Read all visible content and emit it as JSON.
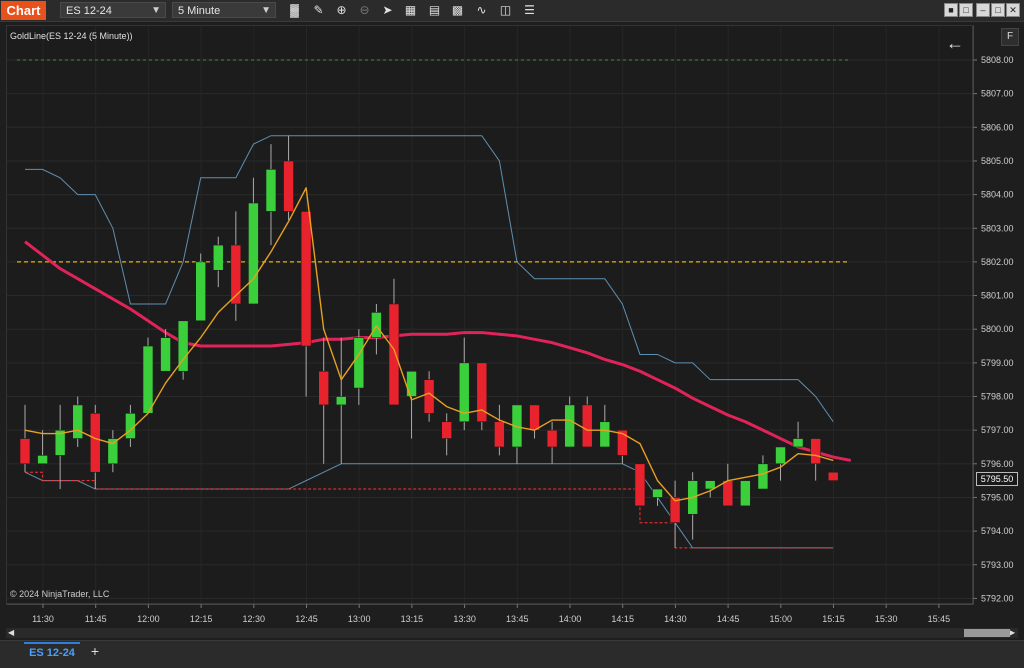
{
  "toolbar": {
    "title": "Chart",
    "instrument": "ES 12-24",
    "interval": "5 Minute",
    "icons": [
      "bar-type-icon",
      "draw-pencil-icon",
      "zoom-in-icon",
      "zoom-out-icon",
      "pointer-icon",
      "properties-icon",
      "strategies-icon",
      "indicators-icon",
      "chart-trader-icon",
      "data-box-icon"
    ]
  },
  "chart": {
    "indicator_label": "GoldLine(ES 12-24 (5 Minute))",
    "copyright": "© 2024 NinjaTrader, LLC",
    "f_button": "F",
    "current_price": "5795.50",
    "price_labels": [
      "5808.00",
      "5807.00",
      "5806.00",
      "5805.00",
      "5804.00",
      "5803.00",
      "5802.00",
      "5801.00",
      "5800.00",
      "5799.00",
      "5798.00",
      "5797.00",
      "5796.00",
      "5795.00",
      "5794.00",
      "5793.00",
      "5792.00"
    ],
    "time_labels": [
      "11:30",
      "11:45",
      "12:00",
      "12:15",
      "12:30",
      "12:45",
      "13:00",
      "13:15",
      "13:30",
      "13:45",
      "14:00",
      "14:15",
      "14:30",
      "14:45",
      "15:00",
      "15:15",
      "15:30",
      "15:45"
    ],
    "colors": {
      "up": "#3ccf3c",
      "down": "#e8232e",
      "ma": "#e0245a",
      "goldline": "#e8a020",
      "channel": "#5f8fb0",
      "hline_green": "#2e9a3a",
      "hline_gold": "#e8b000",
      "stop": "#ff3030"
    }
  },
  "chart_data": {
    "type": "candlestick",
    "title": "GoldLine(ES 12-24 (5 Minute))",
    "ylim": [
      5792,
      5808.5
    ],
    "horizontal_lines": [
      5808.0,
      5802.0
    ],
    "candles": [
      {
        "o": 5796.75,
        "h": 5797.75,
        "l": 5795.75,
        "c": 5796.0
      },
      {
        "o": 5796.0,
        "h": 5797.0,
        "l": 5796.0,
        "c": 5796.25
      },
      {
        "o": 5796.25,
        "h": 5797.75,
        "l": 5795.25,
        "c": 5797.0
      },
      {
        "o": 5796.75,
        "h": 5798.0,
        "l": 5796.5,
        "c": 5797.75
      },
      {
        "o": 5797.5,
        "h": 5797.75,
        "l": 5795.25,
        "c": 5795.75
      },
      {
        "o": 5796.0,
        "h": 5797.0,
        "l": 5795.75,
        "c": 5796.75
      },
      {
        "o": 5796.75,
        "h": 5797.75,
        "l": 5796.5,
        "c": 5797.5
      },
      {
        "o": 5797.5,
        "h": 5799.75,
        "l": 5797.5,
        "c": 5799.5
      },
      {
        "o": 5798.75,
        "h": 5800.0,
        "l": 5798.75,
        "c": 5799.75
      },
      {
        "o": 5798.75,
        "h": 5800.25,
        "l": 5798.5,
        "c": 5800.25
      },
      {
        "o": 5800.25,
        "h": 5802.25,
        "l": 5800.25,
        "c": 5802.0
      },
      {
        "o": 5801.75,
        "h": 5802.75,
        "l": 5801.25,
        "c": 5802.5
      },
      {
        "o": 5802.5,
        "h": 5803.5,
        "l": 5800.25,
        "c": 5800.75
      },
      {
        "o": 5800.75,
        "h": 5804.5,
        "l": 5800.75,
        "c": 5803.75
      },
      {
        "o": 5803.5,
        "h": 5805.5,
        "l": 5802.5,
        "c": 5804.75
      },
      {
        "o": 5805.0,
        "h": 5805.75,
        "l": 5803.25,
        "c": 5803.5
      },
      {
        "o": 5803.5,
        "h": 5803.5,
        "l": 5798.0,
        "c": 5799.5
      },
      {
        "o": 5798.75,
        "h": 5799.75,
        "l": 5796.0,
        "c": 5797.75
      },
      {
        "o": 5797.75,
        "h": 5799.75,
        "l": 5796.0,
        "c": 5798.0
      },
      {
        "o": 5798.25,
        "h": 5800.0,
        "l": 5797.75,
        "c": 5799.75
      },
      {
        "o": 5799.75,
        "h": 5800.75,
        "l": 5799.25,
        "c": 5800.5
      },
      {
        "o": 5800.75,
        "h": 5801.5,
        "l": 5797.75,
        "c": 5797.75
      },
      {
        "o": 5798.0,
        "h": 5798.75,
        "l": 5796.75,
        "c": 5798.75
      },
      {
        "o": 5798.5,
        "h": 5798.75,
        "l": 5797.25,
        "c": 5797.5
      },
      {
        "o": 5797.25,
        "h": 5797.5,
        "l": 5796.25,
        "c": 5796.75
      },
      {
        "o": 5797.25,
        "h": 5799.75,
        "l": 5797.0,
        "c": 5799.0
      },
      {
        "o": 5799.0,
        "h": 5799.0,
        "l": 5797.0,
        "c": 5797.25
      },
      {
        "o": 5797.25,
        "h": 5797.75,
        "l": 5796.25,
        "c": 5796.5
      },
      {
        "o": 5796.5,
        "h": 5797.75,
        "l": 5796.0,
        "c": 5797.75
      },
      {
        "o": 5797.75,
        "h": 5797.75,
        "l": 5796.75,
        "c": 5797.0
      },
      {
        "o": 5797.0,
        "h": 5797.25,
        "l": 5796.0,
        "c": 5796.5
      },
      {
        "o": 5796.5,
        "h": 5798.0,
        "l": 5796.5,
        "c": 5797.75
      },
      {
        "o": 5797.75,
        "h": 5798.0,
        "l": 5796.5,
        "c": 5796.5
      },
      {
        "o": 5796.5,
        "h": 5797.75,
        "l": 5796.5,
        "c": 5797.25
      },
      {
        "o": 5797.0,
        "h": 5797.0,
        "l": 5796.0,
        "c": 5796.25
      },
      {
        "o": 5796.0,
        "h": 5796.0,
        "l": 5795.0,
        "c": 5794.75
      },
      {
        "o": 5795.0,
        "h": 5795.25,
        "l": 5794.75,
        "c": 5795.25
      },
      {
        "o": 5795.0,
        "h": 5795.5,
        "l": 5793.5,
        "c": 5794.25
      },
      {
        "o": 5794.5,
        "h": 5795.75,
        "l": 5793.75,
        "c": 5795.5
      },
      {
        "o": 5795.25,
        "h": 5795.5,
        "l": 5795.0,
        "c": 5795.5
      },
      {
        "o": 5795.5,
        "h": 5796.0,
        "l": 5794.75,
        "c": 5794.75
      },
      {
        "o": 5794.75,
        "h": 5795.5,
        "l": 5794.75,
        "c": 5795.5
      },
      {
        "o": 5795.25,
        "h": 5796.25,
        "l": 5795.25,
        "c": 5796.0
      },
      {
        "o": 5796.0,
        "h": 5796.5,
        "l": 5795.5,
        "c": 5796.5
      },
      {
        "o": 5796.5,
        "h": 5797.25,
        "l": 5796.5,
        "c": 5796.75
      },
      {
        "o": 5796.75,
        "h": 5796.75,
        "l": 5795.5,
        "c": 5796.0
      },
      {
        "o": 5795.75,
        "h": 5795.75,
        "l": 5795.5,
        "c": 5795.5
      }
    ],
    "series": [
      {
        "values": [
          5797.0,
          5796.9,
          5796.9,
          5797.0,
          5796.75,
          5796.6,
          5797.0,
          5797.5,
          5798.4,
          5799.1,
          5799.75,
          5800.5,
          5801.0,
          5801.5,
          5802.3,
          5803.2,
          5804.2,
          5800.0,
          5798.5,
          5799.25,
          5800.1,
          5799.4,
          5797.9,
          5798.1,
          5797.7,
          5797.5,
          5797.6,
          5797.3,
          5797.1,
          5797.0,
          5797.3,
          5797.3,
          5797.0,
          5797.0,
          5796.9,
          5796.6,
          5795.5,
          5794.9,
          5795.0,
          5795.2,
          5795.5,
          5795.6,
          5795.7,
          5795.9,
          5796.3,
          5796.25,
          5796.1
        ]
      },
      {
        "values": [
          5802.6,
          5802.2,
          5801.8,
          5801.5,
          5801.2,
          5800.9,
          5800.6,
          5800.25,
          5799.9,
          5799.6,
          5799.5,
          5799.5,
          5799.5,
          5799.5,
          5799.5,
          5799.55,
          5799.6,
          5799.7,
          5799.7,
          5799.75,
          5799.75,
          5799.8,
          5799.85,
          5799.85,
          5799.85,
          5799.9,
          5799.9,
          5799.85,
          5799.8,
          5799.7,
          5799.6,
          5799.45,
          5799.3,
          5799.1,
          5798.95,
          5798.75,
          5798.5,
          5798.25,
          5797.95,
          5797.7,
          5797.45,
          5797.25,
          5797.0,
          5796.75,
          5796.5,
          5796.35,
          5796.2,
          5796.1
        ]
      },
      {
        "values": [
          5804.75,
          5804.75,
          5804.5,
          5804.0,
          5804.0,
          5803.0,
          5800.75,
          5800.75,
          5800.75,
          5802.0,
          5804.5,
          5804.5,
          5804.5,
          5805.5,
          5805.75,
          5805.75,
          5805.75,
          5805.75,
          5805.75,
          5805.75,
          5805.75,
          5805.75,
          5805.75,
          5805.75,
          5805.75,
          5805.75,
          5805.75,
          5805.0,
          5802.0,
          5801.5,
          5801.5,
          5801.5,
          5801.5,
          5801.5,
          5800.75,
          5799.25,
          5799.25,
          5799.0,
          5799.0,
          5798.5,
          5798.5,
          5798.5,
          5798.5,
          5798.5,
          5798.5,
          5798.0,
          5797.25
        ]
      },
      {
        "values": [
          5795.75,
          5795.5,
          5795.5,
          5795.5,
          5795.25,
          5795.25,
          5795.25,
          5795.25,
          5795.25,
          5795.25,
          5795.25,
          5795.25,
          5795.25,
          5795.25,
          5795.25,
          5795.25,
          5795.5,
          5795.75,
          5796.0,
          5796.0,
          5796.0,
          5796.0,
          5796.0,
          5796.0,
          5796.0,
          5796.0,
          5796.0,
          5796.0,
          5796.0,
          5796.0,
          5796.0,
          5796.0,
          5796.0,
          5796.0,
          5796.0,
          5795.75,
          5795.0,
          5794.25,
          5793.5,
          5793.5,
          5793.5,
          5793.5,
          5793.5,
          5793.5,
          5793.5,
          5793.5,
          5793.5
        ]
      },
      {
        "values": [
          5795.75,
          5795.5,
          5795.5,
          5795.5,
          5795.25,
          5795.25,
          5795.25,
          5795.25,
          5795.25,
          5795.25,
          5795.25,
          5795.25,
          5795.25,
          5795.25,
          5795.25,
          5795.25,
          5795.25,
          5795.25,
          5795.25,
          5795.25,
          5795.25,
          5795.25,
          5795.25,
          5795.25,
          5795.25,
          5795.25,
          5795.25,
          5795.25,
          5795.25,
          5795.25,
          5795.25,
          5795.25,
          5795.25,
          5795.25,
          5795.25,
          5794.25,
          5794.25,
          5793.5,
          5793.5,
          5793.5,
          5793.5,
          5793.5,
          5793.5,
          5793.5,
          5793.5,
          5793.5,
          5793.5
        ]
      }
    ]
  },
  "bottom_tabs": {
    "active": "ES 12-24",
    "add": "+"
  }
}
